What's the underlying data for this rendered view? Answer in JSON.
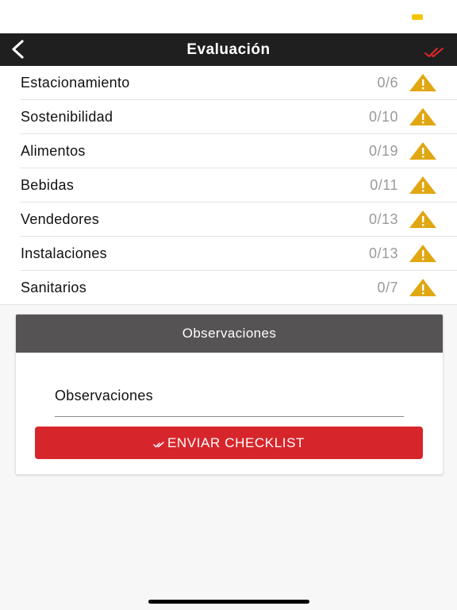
{
  "nav": {
    "title": "Evaluación",
    "back_icon": "chevron-left-icon",
    "done_icon": "double-check-icon",
    "accent": "#d7262b"
  },
  "categories": [
    {
      "label": "Estacionamiento",
      "count": "0/6"
    },
    {
      "label": "Sostenibilidad",
      "count": "0/10"
    },
    {
      "label": "Alimentos",
      "count": "0/19"
    },
    {
      "label": "Bebidas",
      "count": "0/11"
    },
    {
      "label": "Vendedores",
      "count": "0/13"
    },
    {
      "label": "Instalaciones",
      "count": "0/13"
    },
    {
      "label": "Sanitarios",
      "count": "0/7"
    }
  ],
  "status_icon": "warning-icon",
  "warning_color": "#e0a712",
  "observations": {
    "header": "Observaciones",
    "placeholder": "Observaciones",
    "value": ""
  },
  "submit": {
    "label": "ENVIAR CHECKLIST",
    "icon": "double-check-icon",
    "color": "#d7262b"
  }
}
